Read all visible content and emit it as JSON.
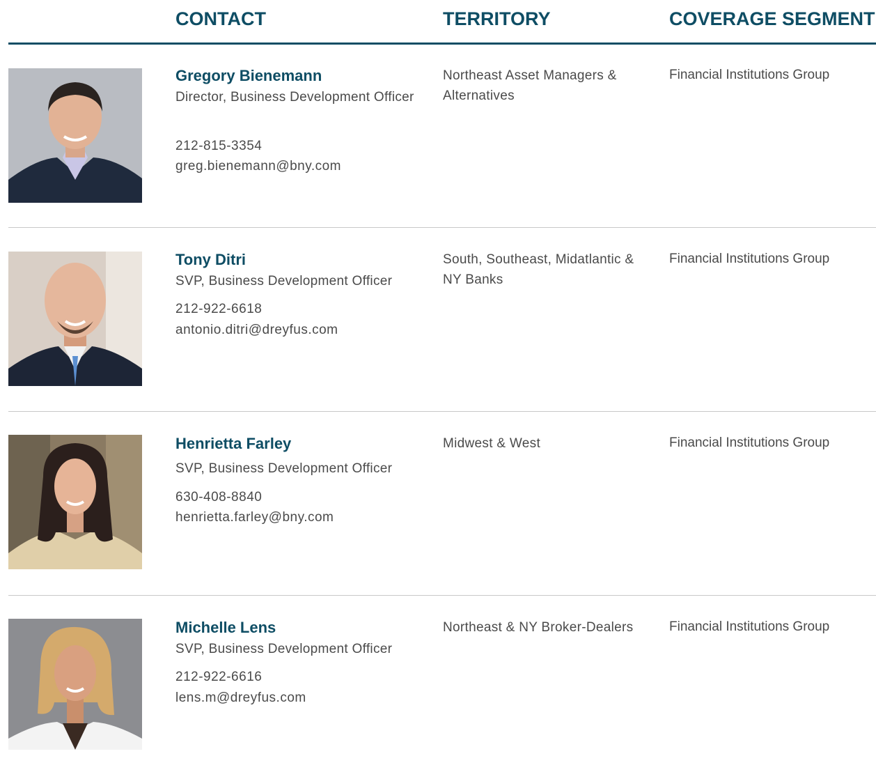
{
  "headers": {
    "contact": "CONTACT",
    "territory": "TERRITORY",
    "coverage": "COVERAGE SEGMENT"
  },
  "contacts": [
    {
      "name": "Gregory Bienemann",
      "title": "Director, Business Development Officer",
      "phone": "212-815-3354",
      "email": "greg.bienemann@bny.com",
      "territory": "Northeast Asset Managers & Alternatives",
      "coverage": "Financial Institutions Group"
    },
    {
      "name": "Tony Ditri",
      "title": "SVP, Business Development Officer",
      "phone": "212-922-6618",
      "email": "antonio.ditri@dreyfus.com",
      "territory": "South, Southeast, Midatlantic & NY Banks",
      "coverage": "Financial Institutions Group"
    },
    {
      "name": "Henrietta Farley",
      "title": "SVP, Business Development Officer",
      "phone": "630-408-8840",
      "email": "henrietta.farley@bny.com",
      "territory": "Midwest & West",
      "coverage": "Financial Institutions Group"
    },
    {
      "name": "Michelle Lens",
      "title": "SVP, Business Development Officer",
      "phone": "212-922-6616",
      "email": "lens.m@dreyfus.com",
      "territory": "Northeast & NY Broker-Dealers",
      "coverage": "Financial Institutions Group"
    }
  ],
  "colors": {
    "accent": "#0e4d64",
    "text": "#4a4a4a",
    "divider": "#c8c8c8"
  }
}
